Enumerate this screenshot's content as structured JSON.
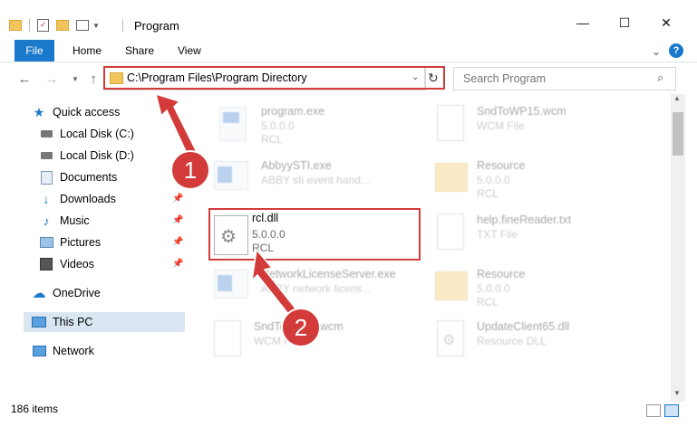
{
  "window": {
    "title": "Program",
    "minimize_glyph": "—",
    "maximize_glyph": "☐",
    "close_glyph": "✕"
  },
  "ribbon": {
    "tabs": [
      {
        "label": "File"
      },
      {
        "label": "Home"
      },
      {
        "label": "Share"
      },
      {
        "label": "View"
      }
    ],
    "help_glyph": "?"
  },
  "address_bar": {
    "path": "C:\\Program Files\\Program Directory"
  },
  "search": {
    "placeholder": "Search Program"
  },
  "sidebar": {
    "items": [
      {
        "label": "Quick access",
        "icon": "star-icon",
        "pinned": false
      },
      {
        "label": "Local Disk (C:)",
        "icon": "drive-icon",
        "pinned": false
      },
      {
        "label": "Local Disk (D:)",
        "icon": "drive-icon",
        "pinned": false
      },
      {
        "label": "Documents",
        "icon": "documents-icon",
        "pinned": true
      },
      {
        "label": "Downloads",
        "icon": "download-icon",
        "pinned": true
      },
      {
        "label": "Music",
        "icon": "music-icon",
        "pinned": true
      },
      {
        "label": "Pictures",
        "icon": "pictures-icon",
        "pinned": true
      },
      {
        "label": "Videos",
        "icon": "videos-icon",
        "pinned": true
      },
      {
        "label": "OneDrive",
        "icon": "cloud-icon",
        "pinned": false
      },
      {
        "label": "This PC",
        "icon": "computer-icon",
        "pinned": false,
        "selected": true
      },
      {
        "label": "Network",
        "icon": "network-icon",
        "pinned": false
      }
    ]
  },
  "files": [
    {
      "name": "program.exe",
      "line2": "5.0.0.0",
      "line3": "RCL",
      "icon": "exe-icon",
      "faded": true
    },
    {
      "name": "SndToWP15.wcm",
      "line2": "WCM File",
      "line3": "",
      "icon": "generic-file-icon",
      "faded": true
    },
    {
      "name": "AbbyySTI.exe",
      "line2": "ABBY sti event hand...",
      "line3": "",
      "icon": "exe-icon",
      "faded": true
    },
    {
      "name": "Resource",
      "line2": "5.0.0.0",
      "line3": "RCL",
      "icon": "folder-icon",
      "faded": true
    },
    {
      "name": "rcl.dll",
      "line2": "5.0.0.0",
      "line3": "RCL",
      "icon": "dll-gear-icon",
      "faded": false
    },
    {
      "name": "help.fineReader.txt",
      "line2": "TXT File",
      "line3": "",
      "icon": "generic-file-icon",
      "faded": true
    },
    {
      "name": "NetworkLicenseServer.exe",
      "line2": "ABBY network licens...",
      "line3": "",
      "icon": "exe-icon",
      "faded": true
    },
    {
      "name": "Resource",
      "line2": "5.0.0.0",
      "line3": "RCL",
      "icon": "folder-icon",
      "faded": true
    },
    {
      "name": "SndToWP15.wcm",
      "line2": "WCM File",
      "line3": "",
      "icon": "generic-file-icon",
      "faded": true
    },
    {
      "name": "UpdateClient65.dll",
      "line2": "Resource DLL",
      "line3": "",
      "icon": "dll-gear-icon",
      "faded": true
    }
  ],
  "status_bar": {
    "item_count": "186 items"
  },
  "callouts": [
    {
      "number": "1"
    },
    {
      "number": "2"
    }
  ],
  "colors": {
    "accent": "#1979ca",
    "highlight": "#d33a3a",
    "selected_row": "#d9e6f2",
    "folder": "#f2c55c"
  }
}
